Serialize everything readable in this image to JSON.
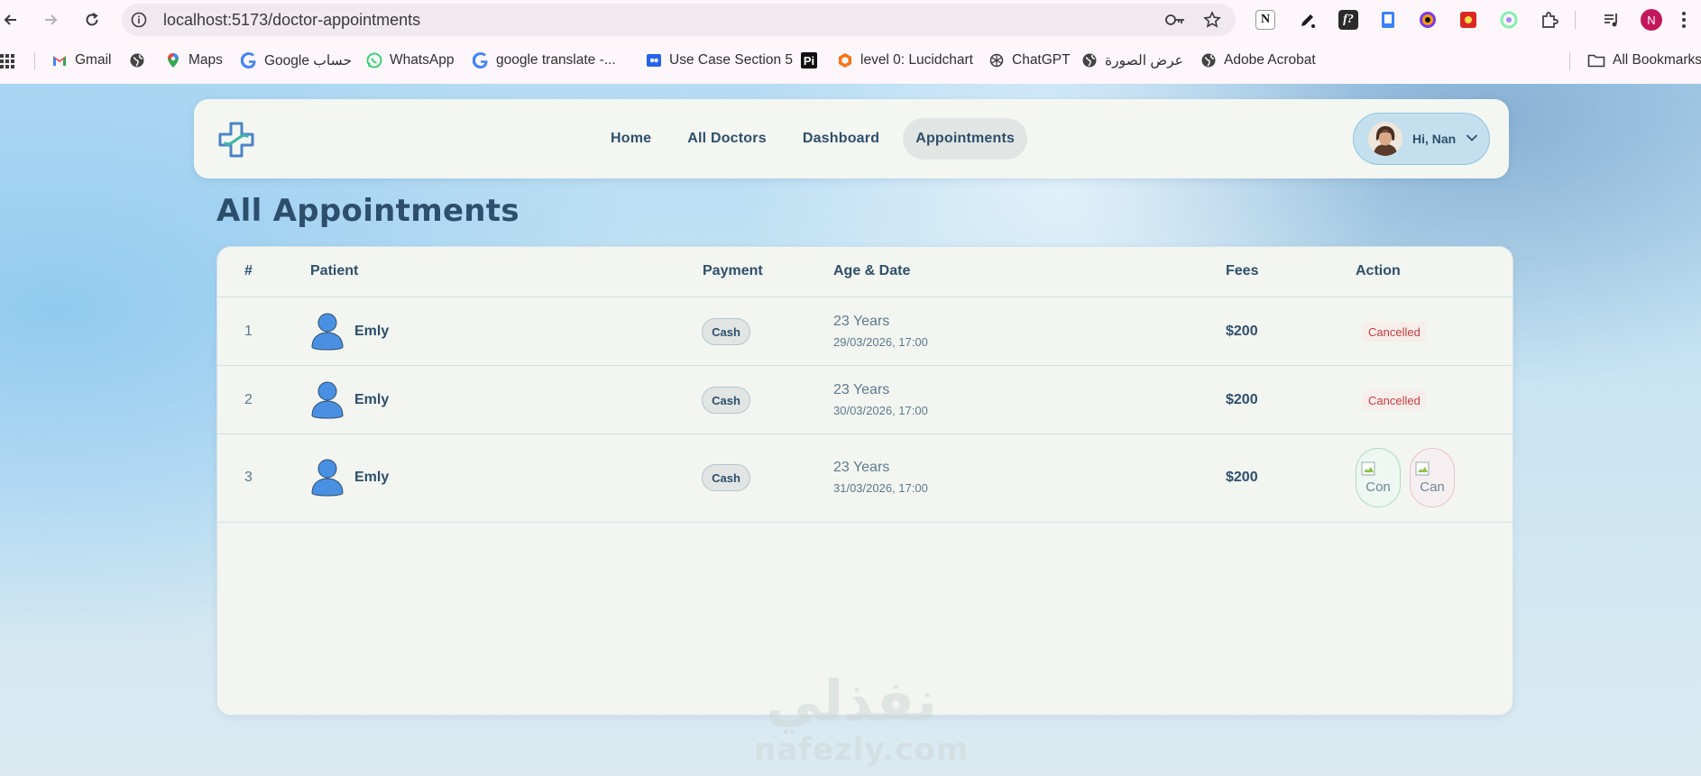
{
  "browser": {
    "url": "localhost:5173/doctor-appointments",
    "profile_initial": "N",
    "bookmarks": [
      {
        "label": "Gmail",
        "icon": "gmail-icon"
      },
      {
        "label": "",
        "icon": "globe-icon"
      },
      {
        "label": "Maps",
        "icon": "maps-icon"
      },
      {
        "label": "Google حساب",
        "icon": "google-icon"
      },
      {
        "label": "WhatsApp",
        "icon": "whatsapp-icon"
      },
      {
        "label": "google translate -...",
        "icon": "google-icon"
      },
      {
        "label": "Use Case Section 5",
        "icon": "usecase-icon"
      },
      {
        "label": "",
        "icon": "pi-icon"
      },
      {
        "label": "level 0: Lucidchart",
        "icon": "lucidchart-icon"
      },
      {
        "label": "ChatGPT",
        "icon": "chatgpt-icon"
      },
      {
        "label": "عرض الصورة",
        "icon": "globe-icon"
      },
      {
        "label": "Adobe Acrobat",
        "icon": "globe-icon"
      }
    ],
    "all_bookmarks": "All Bookmarks",
    "extensions": [
      {
        "icon": "notion-icon",
        "glyph": "N",
        "color": "#ffffff"
      },
      {
        "icon": "pen-icon",
        "glyph": "✎",
        "color": "#1b1b1b"
      },
      {
        "icon": "formula-icon",
        "glyph": "f?",
        "color": "#2b2b2b"
      },
      {
        "icon": "clipboard-icon",
        "glyph": "▯",
        "color": "#3b82f6"
      },
      {
        "icon": "color-picker-icon",
        "glyph": "◉",
        "color": "#7c3aed"
      },
      {
        "icon": "puzzle-game-icon",
        "glyph": "✦",
        "color": "#dc2626"
      },
      {
        "icon": "chatgpt-ext-icon",
        "glyph": "✺",
        "color": "#a7f3d0"
      },
      {
        "icon": "extensions-icon",
        "glyph": "⧉",
        "color": "#ffffff"
      },
      {
        "icon": "media-icon",
        "glyph": "♫",
        "color": "#ffffff"
      }
    ]
  },
  "nav": {
    "links": [
      {
        "label": "Home",
        "active": false
      },
      {
        "label": "All Doctors",
        "active": false
      },
      {
        "label": "Dashboard",
        "active": false
      },
      {
        "label": "Appointments",
        "active": true
      }
    ],
    "user_greeting": "Hi, Nan"
  },
  "page": {
    "title": "All Appointments"
  },
  "table": {
    "headers": [
      "#",
      "Patient",
      "Payment",
      "Age & Date",
      "Fees",
      "Action"
    ],
    "rows": [
      {
        "num": "1",
        "patient": "Emly",
        "payment": "Cash",
        "age": "23 Years",
        "date": "29/03/2026, 17:00",
        "fees": "$200",
        "status": "Cancelled"
      },
      {
        "num": "2",
        "patient": "Emly",
        "payment": "Cash",
        "age": "23 Years",
        "date": "30/03/2026, 17:00",
        "fees": "$200",
        "status": "Cancelled"
      },
      {
        "num": "3",
        "patient": "Emly",
        "payment": "Cash",
        "age": "23 Years",
        "date": "31/03/2026, 17:00",
        "fees": "$200",
        "status": ""
      }
    ],
    "actions": {
      "confirm_alt": "Con",
      "cancel_alt": "Can"
    }
  },
  "watermark": {
    "arabic": "نفذلي",
    "latin": "nafezly.com"
  },
  "colors": {
    "primary": "#2d4f6c",
    "cancelled": "#c53d3d",
    "active_nav": "#e1e5e3",
    "user_pill": "#c4e0ef"
  }
}
